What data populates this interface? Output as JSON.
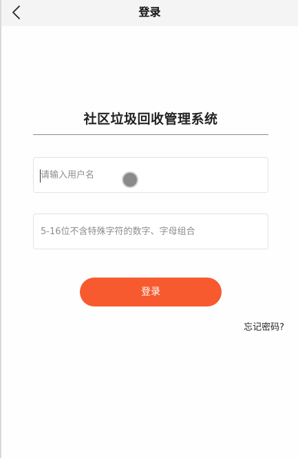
{
  "navbar": {
    "title": "登录",
    "back_icon": "chevron-left-icon"
  },
  "app": {
    "title": "社区垃圾回收管理系统"
  },
  "form": {
    "username_placeholder": "请输入用户名",
    "username_value": "",
    "password_placeholder": "5-16位不含特殊字符的数字、字母组合",
    "password_value": "",
    "login_label": "登录",
    "forgot_label": "忘记密码?"
  },
  "colors": {
    "accent": "#f75a2f",
    "navbar_bg": "#f4f4f4",
    "text": "#222222",
    "placeholder": "#8c8c8c"
  }
}
